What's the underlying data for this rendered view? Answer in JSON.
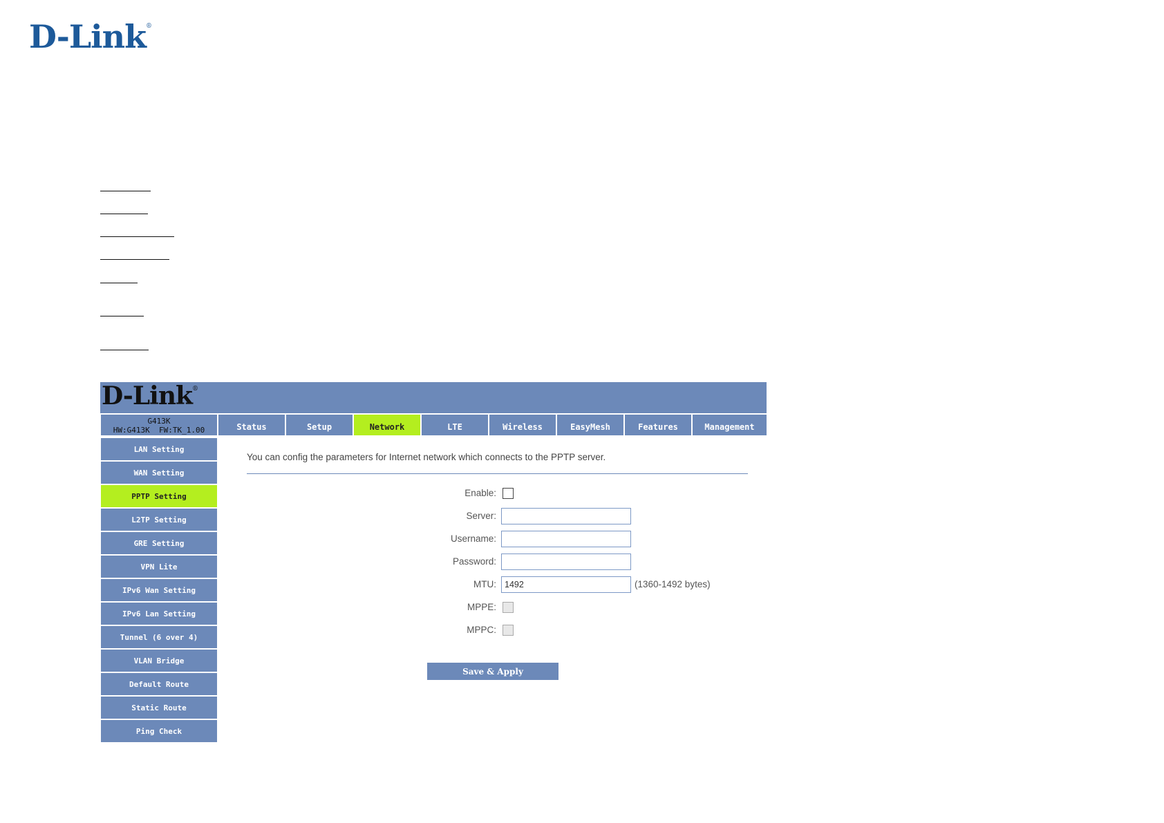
{
  "brand": {
    "name": "D-Link",
    "registered": "®"
  },
  "device": {
    "model": "G413K",
    "hw": "HW:G413K",
    "fw": "FW:TK_1.00"
  },
  "tabs": [
    {
      "label": "Status"
    },
    {
      "label": "Setup"
    },
    {
      "label": "Network",
      "active": true
    },
    {
      "label": "LTE"
    },
    {
      "label": "Wireless"
    },
    {
      "label": "EasyMesh"
    },
    {
      "label": "Features"
    },
    {
      "label": "Management"
    }
  ],
  "sidebar": [
    {
      "label": "LAN Setting"
    },
    {
      "label": "WAN Setting"
    },
    {
      "label": "PPTP Setting",
      "active": true
    },
    {
      "label": "L2TP Setting"
    },
    {
      "label": "GRE Setting"
    },
    {
      "label": "VPN Lite"
    },
    {
      "label": "IPv6 Wan Setting"
    },
    {
      "label": "IPv6 Lan Setting"
    },
    {
      "label": "Tunnel (6 over 4)"
    },
    {
      "label": "VLAN Bridge"
    },
    {
      "label": "Default Route"
    },
    {
      "label": "Static Route"
    },
    {
      "label": "Ping Check"
    }
  ],
  "main": {
    "intro": "You can config the parameters for Internet network which connects to the PPTP server.",
    "form": {
      "enable_label": "Enable:",
      "server_label": "Server:",
      "server_value": "",
      "username_label": "Username:",
      "username_value": "",
      "password_label": "Password:",
      "password_value": "",
      "mtu_label": "MTU:",
      "mtu_value": "1492",
      "mtu_hint": "(1360-1492 bytes)",
      "mppe_label": "MPPE:",
      "mppc_label": "MPPC:"
    },
    "save_label": "Save & Apply"
  },
  "colors": {
    "nav": "#6c89b9",
    "active": "#b4ee1f",
    "logo": "#1d5a9a"
  }
}
